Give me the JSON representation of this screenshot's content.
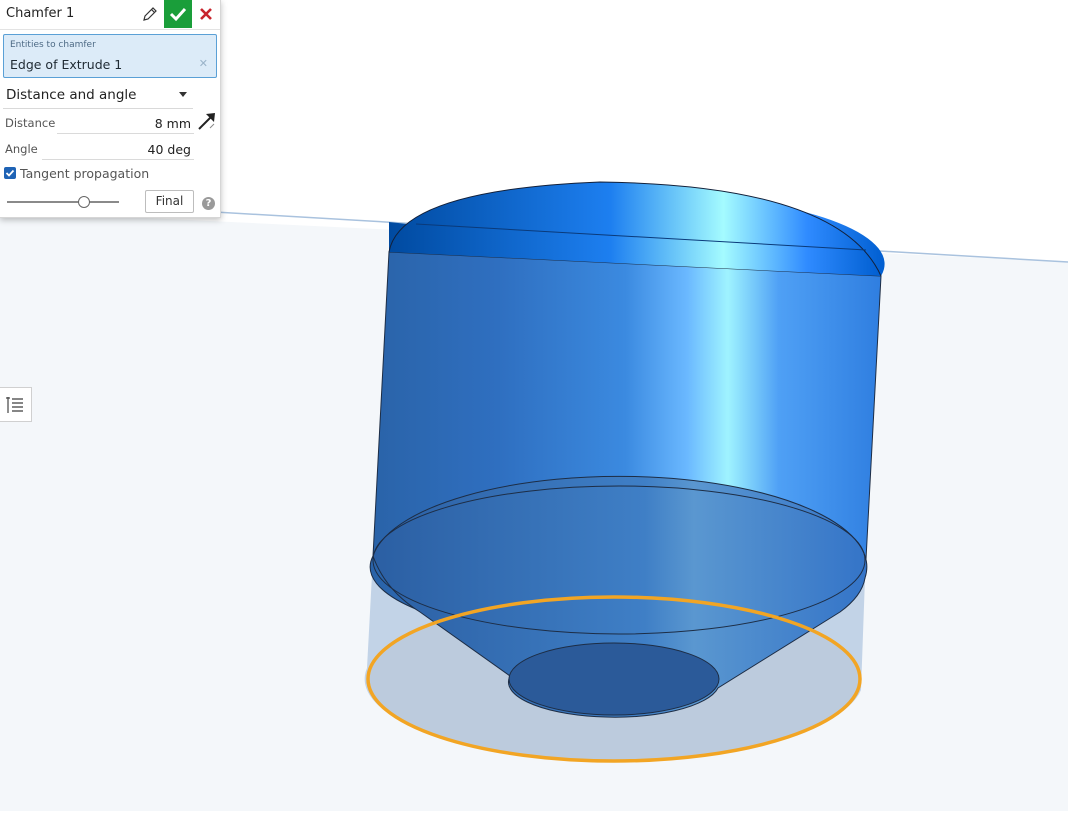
{
  "dialog": {
    "title": "Chamfer 1",
    "entities": {
      "label": "Entities to chamfer",
      "value": "Edge of Extrude 1"
    },
    "measurement_type": "Distance and angle",
    "distance": {
      "label": "Distance",
      "value": "8 mm"
    },
    "angle": {
      "label": "Angle",
      "value": "40 deg"
    },
    "tangent_propagation": {
      "label": "Tangent propagation",
      "checked": true
    },
    "final_button": "Final",
    "help_glyph": "?",
    "slider_level": 0.69,
    "accent_colors": {
      "ok_green": "#1a9e3a",
      "cancel_red": "#c8232c",
      "selection_blue": "#5aa0d6",
      "edge_highlight_orange": "#f2a524"
    }
  },
  "icons": {
    "edit": "pencil-icon",
    "accept": "check-icon",
    "cancel": "close-icon",
    "clear": "clear-x-icon",
    "dropdown": "chevron-down-icon",
    "direction": "flip-direction-arrow-icon",
    "list": "numbered-list-icon"
  }
}
